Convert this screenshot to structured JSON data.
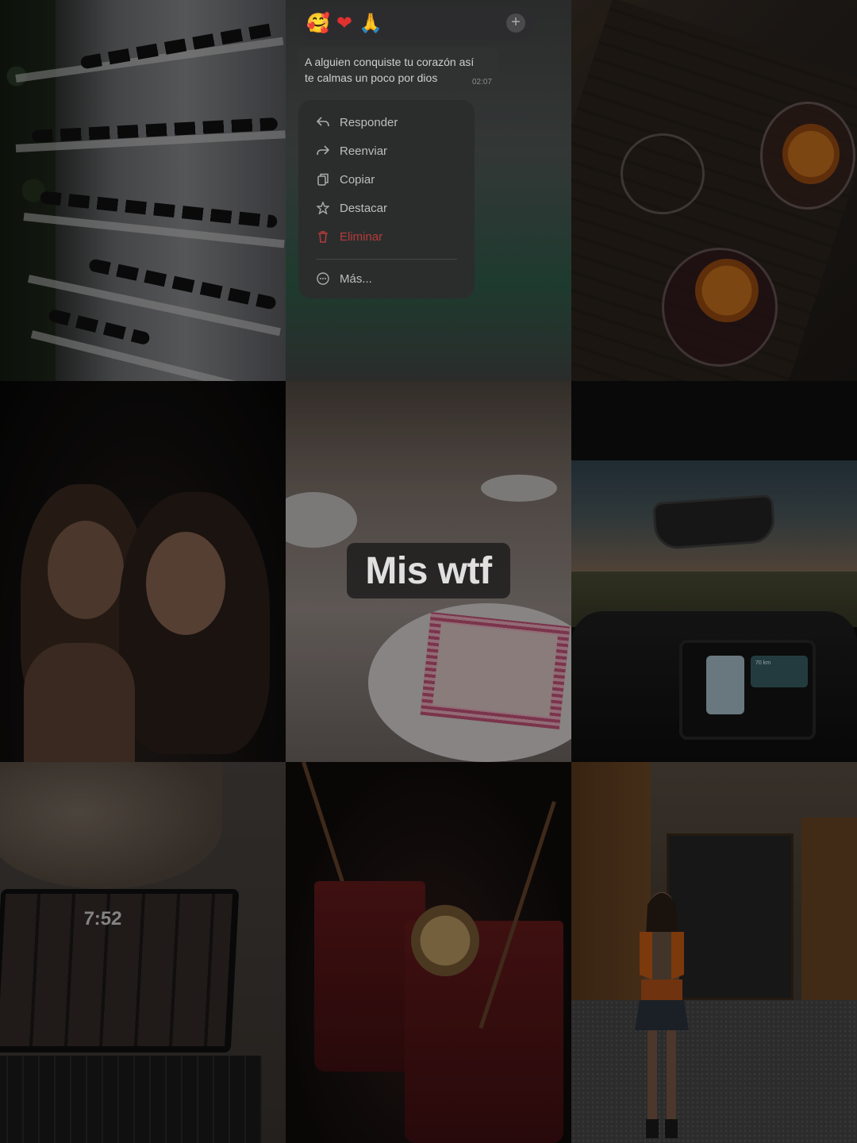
{
  "chat": {
    "reactions": [
      "👍",
      "❤",
      "😂",
      "😮",
      "😢",
      "🙏",
      "🥰"
    ],
    "add_reaction": "+",
    "message_line1": "A alguien conquiste tu corazón así",
    "message_line2": "te calmas un poco por dios",
    "message_time": "02:07",
    "menu": {
      "reply": "Responder",
      "forward": "Reenviar",
      "copy": "Copiar",
      "star": "Destacar",
      "delete": "Eliminar",
      "more": "Más..."
    }
  },
  "collage_title": "Mis wtf",
  "laptop_clock": "7:52",
  "car_screen": {
    "distance": "70 km"
  },
  "colors": {
    "danger": "#b83a3a",
    "menu_bg": "#2b2d2d"
  }
}
